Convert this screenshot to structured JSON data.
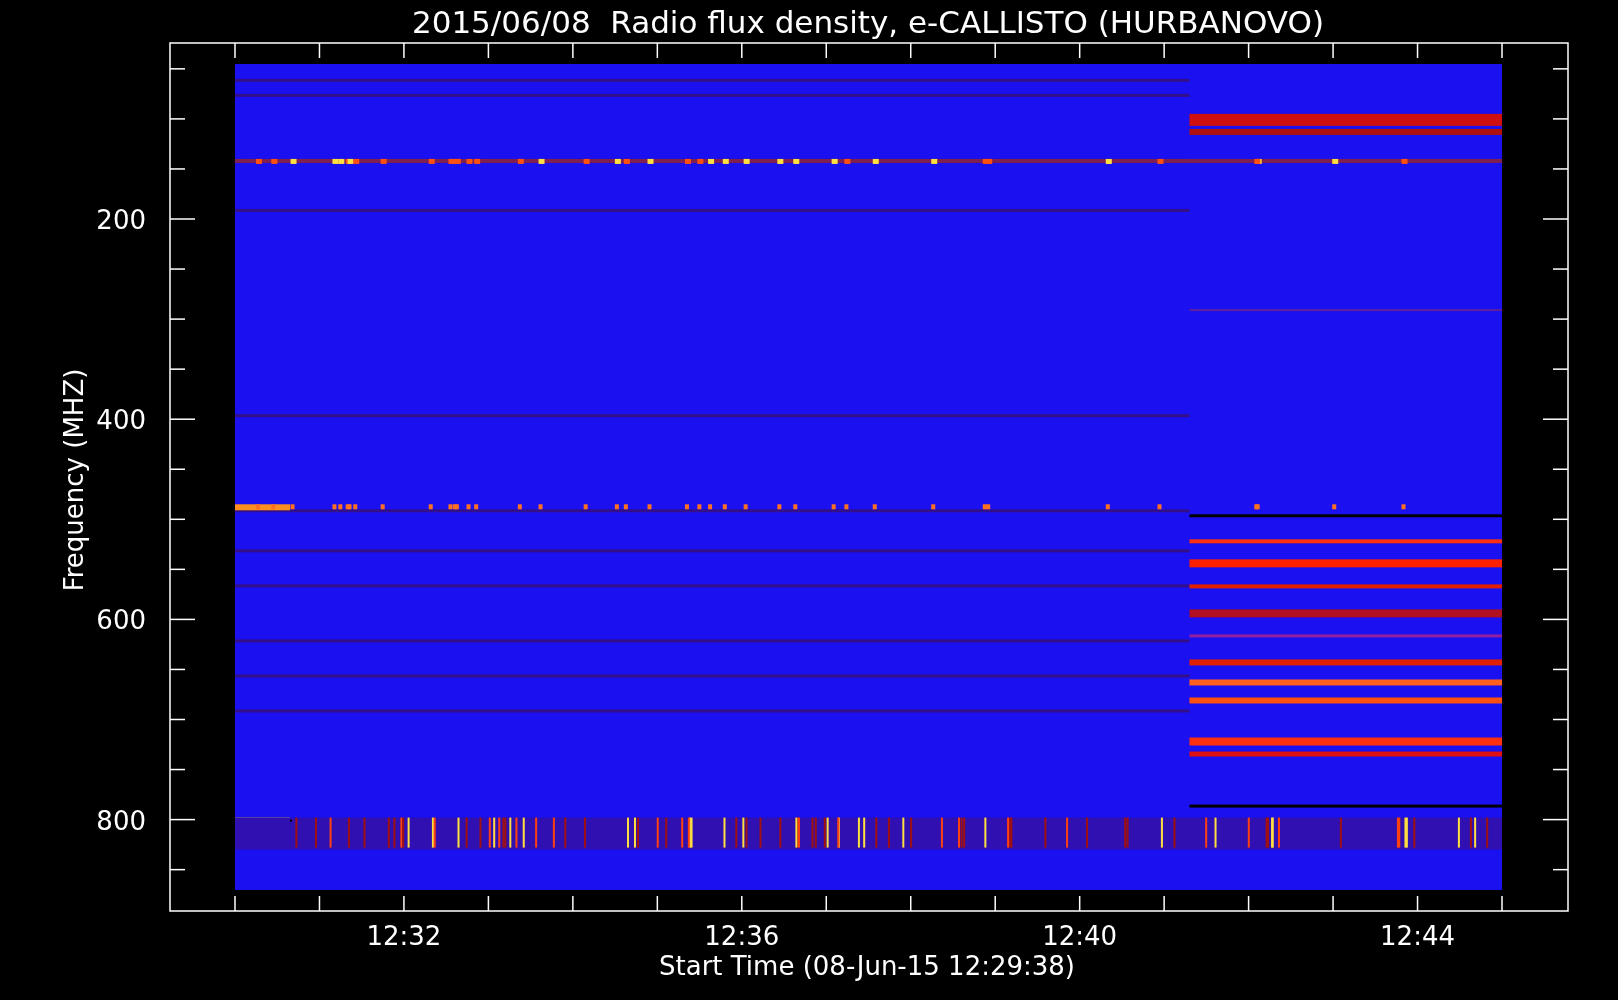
{
  "title": "2015/06/08  Radio flux density, e-CALLISTO (HURBANOVO)",
  "y_axis": {
    "label": "Frequency (MHZ)",
    "ticks": [
      "200",
      "400",
      "600",
      "800"
    ]
  },
  "x_axis": {
    "label": "Start Time (08-Jun-15 12:29:38)",
    "ticks": [
      "12:32",
      "12:36",
      "12:40",
      "12:44"
    ]
  }
}
